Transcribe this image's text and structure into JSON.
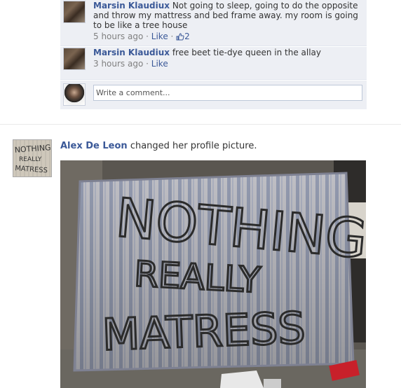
{
  "comments": [
    {
      "author": "Marsin Klaudiux",
      "text": "Not going to sleep, going to do the opposite and throw my mattress and bed frame away. my room is going to be like a tree house",
      "time": "5 hours ago",
      "like_label": "Like",
      "like_count": "2"
    },
    {
      "author": "Marsin Klaudiux",
      "text": "free beet tie-dye queen in the allay",
      "time": "3 hours ago",
      "like_label": "Like"
    }
  ],
  "comment_box": {
    "placeholder": "Write a comment..."
  },
  "story": {
    "author": "Alex De Leon",
    "action": "changed her profile picture."
  },
  "photo": {
    "painted_text": [
      "NOTHING",
      "REALLY",
      "MATRESS"
    ]
  },
  "colors": {
    "link": "#3b5998",
    "comment_bg": "#edeff4",
    "meta": "#808080"
  },
  "icons": [
    "thumbs-up-icon"
  ]
}
